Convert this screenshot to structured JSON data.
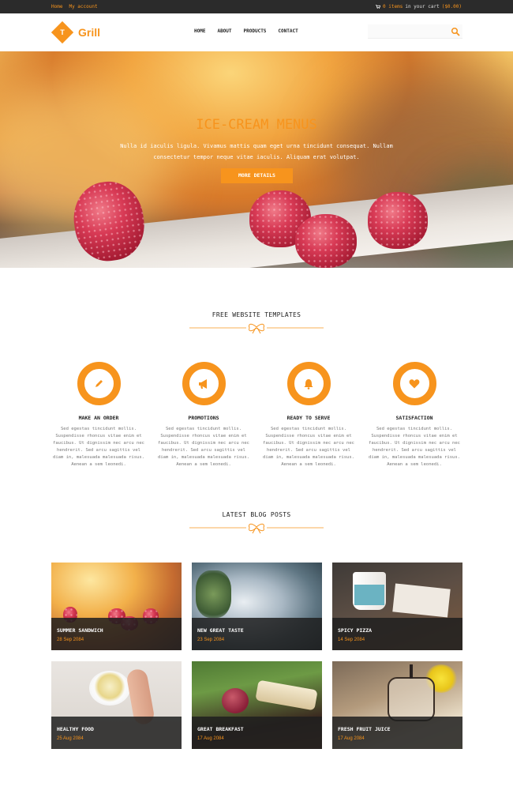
{
  "topbar": {
    "home": "Home",
    "account": "My account",
    "cart_count": "0 items",
    "cart_text": "in your cart",
    "cart_total": "($0.00)"
  },
  "brand": {
    "name": "Grill",
    "accent": "#f7941d"
  },
  "nav": [
    "HOME",
    "ABOUT",
    "PRODUCTS",
    "CONTACT"
  ],
  "search": {
    "placeholder": ""
  },
  "hero": {
    "title": "ICE-CREAM MENUS",
    "text": "Nulla id iaculis ligula. Vivamus mattis quam eget urna tincidunt consequat. Nullam consectetur tempor neque vitae iaculis. Aliquam erat volutpat.",
    "button": "MORE DETAILS"
  },
  "features_title": "FREE WEBSITE TEMPLATES",
  "features": [
    {
      "icon": "pencil-icon",
      "title": "MAKE AN ORDER",
      "text": "Sed egestas tincidunt mollis. Suspendisse rhoncus vitae enim et faucibus. Ut dignissim nec arcu nec hendrerit. Sed arcu sagittis vel diam in, malesuada malesuada risus. Aenean a sem leonedi."
    },
    {
      "icon": "megaphone-icon",
      "title": "PROMOTIONS",
      "text": "Sed egestas tincidunt mollis. Suspendisse rhoncus vitae enim et faucibus. Ut dignissim nec arcu nec hendrerit. Sed arcu sagittis vel diam in, malesuada malesuada risus. Aenean a sem leonedi."
    },
    {
      "icon": "bell-icon",
      "title": "READY TO SERVE",
      "text": "Sed egestas tincidunt mollis. Suspendisse rhoncus vitae enim et faucibus. Ut dignissim nec arcu nec hendrerit. Sed arcu sagittis vel diam in, malesuada malesuada risus. Aenean a sem leonedi."
    },
    {
      "icon": "heart-icon",
      "title": "SATISFACTION",
      "text": "Sed egestas tincidunt mollis. Suspendisse rhoncus vitae enim et faucibus. Ut dignissim nec arcu nec hendrerit. Sed arcu sagittis vel diam in, malesuada malesuada risus. Aenean a sem leonedi."
    }
  ],
  "blog_title": "LATEST BLOG POSTS",
  "posts": [
    {
      "title": "SUMMER SANDWICH",
      "date": "28 Sep 2084"
    },
    {
      "title": "NEW GREAT TASTE",
      "date": "23 Sep 2084"
    },
    {
      "title": "SPICY PIZZA",
      "date": "14 Sep 2084"
    },
    {
      "title": "HEALTHY FOOD",
      "date": "25 Aug 2084"
    },
    {
      "title": "GREAT BREAKFAST",
      "date": "17 Aug 2084"
    },
    {
      "title": "FRESH FRUIT JUICE",
      "date": "17 Aug 2084"
    }
  ]
}
